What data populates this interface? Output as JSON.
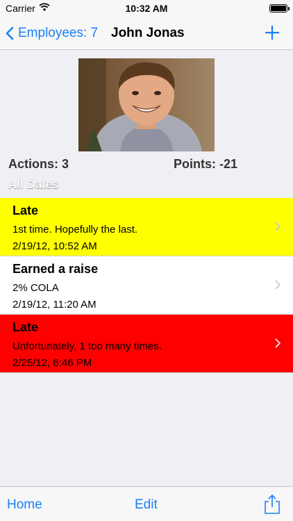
{
  "status_bar": {
    "carrier": "Carrier",
    "time": "10:32 AM",
    "battery_level": 1.0
  },
  "nav": {
    "back_label": "Employees: 7",
    "title": "John Jonas",
    "add_icon": "plus-icon",
    "accent_color": "#1a7ff5"
  },
  "employee": {
    "photo": "employee-photo",
    "actions_label": "Actions: 3",
    "points_label": "Points: -21",
    "filter_label": "All Dates"
  },
  "actions": [
    {
      "title": "Late",
      "description": "1st time.  Hopefully the last.",
      "timestamp": "2/19/12, 10:52 AM",
      "color": "#ffff00"
    },
    {
      "title": "Earned a raise",
      "description": "2% COLA",
      "timestamp": "2/19/12, 11:20 AM",
      "color": "#ffffff"
    },
    {
      "title": "Late",
      "description": "Unfortunately, 1 too many times.",
      "timestamp": "2/25/12, 6:46 PM",
      "color": "#ff0000"
    }
  ],
  "toolbar": {
    "home_label": "Home",
    "edit_label": "Edit",
    "share_icon": "share-icon"
  }
}
